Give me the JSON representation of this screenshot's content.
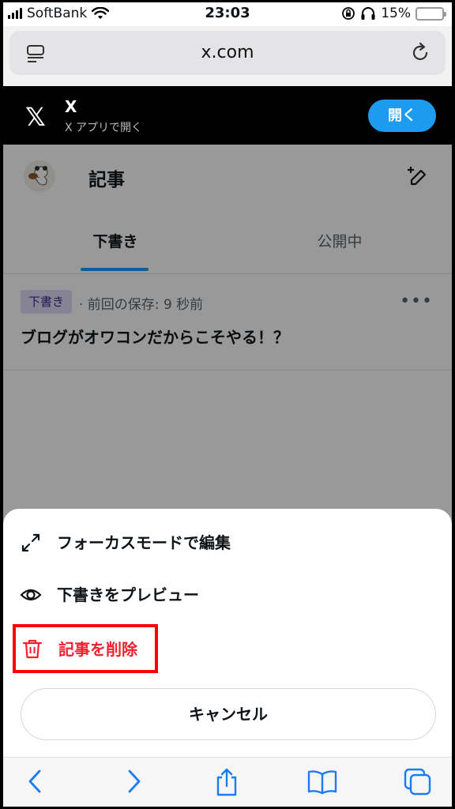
{
  "status_bar": {
    "carrier": "SoftBank",
    "time": "23:03",
    "battery_percent": "15%",
    "battery_level": 0.15,
    "battery_color": "#f5c400"
  },
  "browser": {
    "url": "x.com",
    "tab_icon": "tab-list-icon",
    "reload_icon": "reload-icon"
  },
  "app_banner": {
    "app_name": "X",
    "subtitle": "X アプリで開く",
    "open_label": "開く",
    "accent": "#1d9bf0"
  },
  "header": {
    "title": "記事"
  },
  "tabs": [
    {
      "label": "下書き",
      "active": true
    },
    {
      "label": "公開中",
      "active": false
    }
  ],
  "draft": {
    "badge": "下書き",
    "meta": "· 前回の保存: 9 秒前",
    "title": "ブログがオワコンだからこそやる！？"
  },
  "sheet": {
    "items": [
      {
        "label": "フォーカスモードで編集",
        "icon": "expand-icon"
      },
      {
        "label": "下書きをプレビュー",
        "icon": "eye-icon"
      },
      {
        "label": "記事を削除",
        "icon": "trash-icon",
        "color": "#f4212e"
      }
    ],
    "cancel_label": "キャンセル"
  }
}
